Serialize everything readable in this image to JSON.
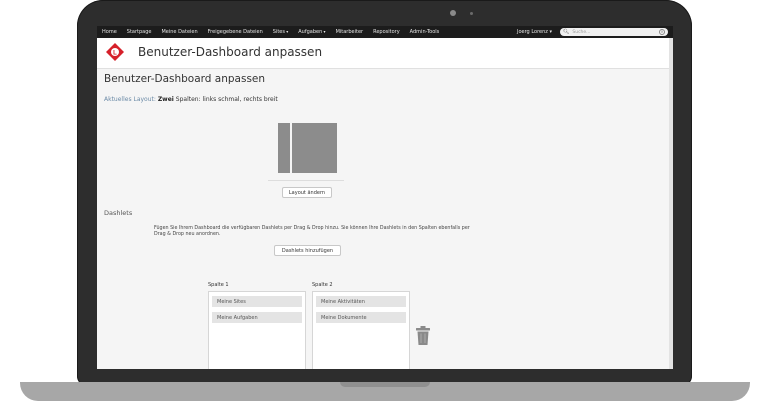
{
  "nav": {
    "items": [
      {
        "label": "Home",
        "dropdown": false
      },
      {
        "label": "Startpage",
        "dropdown": false
      },
      {
        "label": "Meine Dateien",
        "dropdown": false
      },
      {
        "label": "Freigegebene Dateien",
        "dropdown": false
      },
      {
        "label": "Sites",
        "dropdown": true
      },
      {
        "label": "Aufgaben",
        "dropdown": true
      },
      {
        "label": "Mitarbeiter",
        "dropdown": false
      },
      {
        "label": "Repository",
        "dropdown": false
      },
      {
        "label": "Admin-Tools",
        "dropdown": false
      }
    ],
    "user": "Joerg Lorenz ▾",
    "search_placeholder": "Suche..."
  },
  "header": {
    "title": "Benutzer-Dashboard anpassen"
  },
  "page": {
    "heading": "Benutzer-Dashboard anpassen",
    "current_layout_label": "Aktuelles Layout:",
    "current_layout_bold": "Zwei",
    "current_layout_rest": "Spalten: links schmal, rechts breit",
    "change_layout_button": "Layout ändern"
  },
  "dashlets": {
    "heading": "Dashlets",
    "info": "Fügen Sie Ihrem Dashboard die verfügbaren Dashlets per Drag & Drop hinzu. Sie können Ihre Dashlets in den Spalten ebenfalls per Drag & Drop neu anordnen.",
    "add_button": "Dashlets hinzufügen",
    "columns": [
      {
        "label": "Spalte 1",
        "items": [
          "Meine Sites",
          "Meine Aufgaben"
        ]
      },
      {
        "label": "Spalte 2",
        "items": [
          "Meine Aktivitäten",
          "Meine Dokumente"
        ]
      }
    ]
  },
  "colors": {
    "nav_bg": "#1c1c1c",
    "logo_red": "#d6202a",
    "layout_grey": "#8c8c8c"
  }
}
